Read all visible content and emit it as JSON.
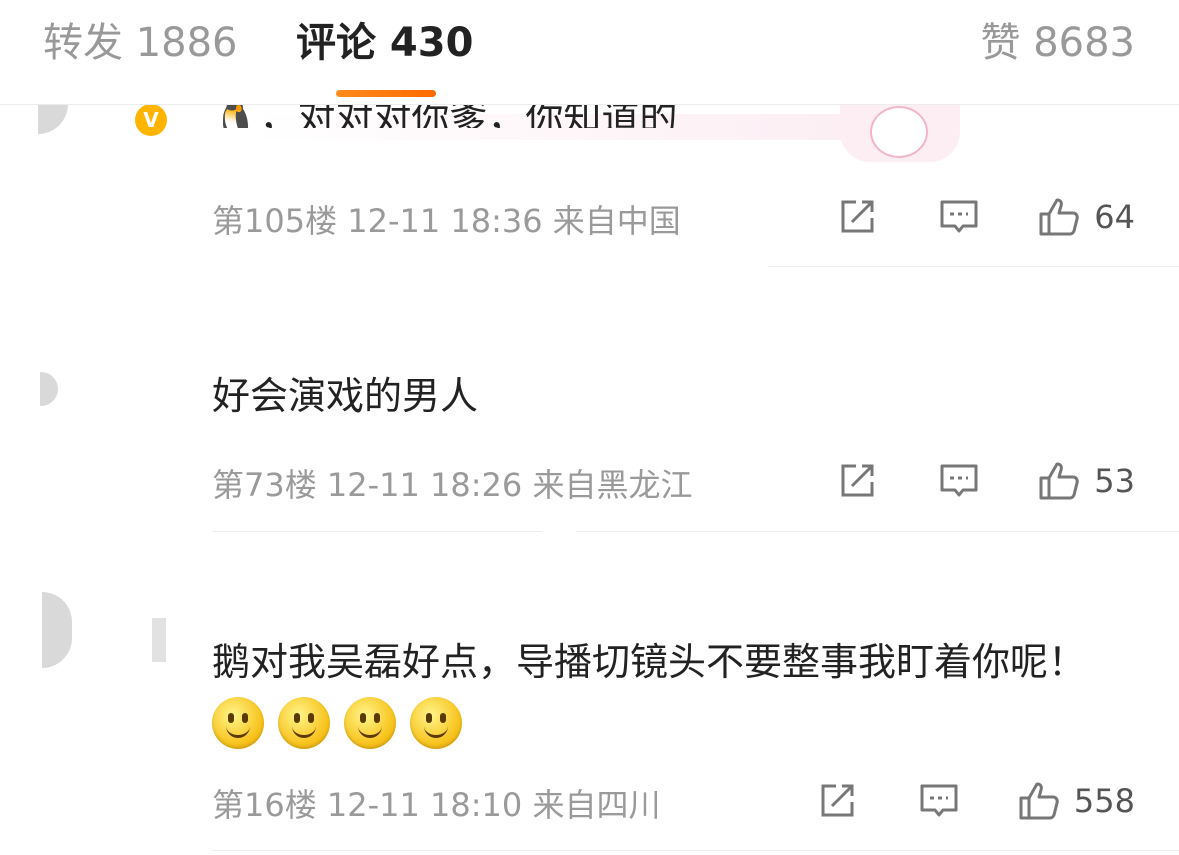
{
  "tabs": {
    "forward": "转发 1886",
    "comments": "评论 430",
    "likes": "赞 8683"
  },
  "comments": [
    {
      "text_partial": "🐧，对对对你爹，你知道的",
      "verified_badge": "V",
      "meta": "第105楼 12-11 18:36 来自中国",
      "likes": "64"
    },
    {
      "text": "好会演戏的男人",
      "meta": "第73楼 12-11 18:26 来自黑龙江",
      "likes": "53"
    },
    {
      "text": "鹅对我吴磊好点，导播切镜头不要整事我盯着你呢！",
      "emoji_count": 4,
      "meta": "第16楼 12-11 18:10 来自四川",
      "likes": "558"
    }
  ],
  "icons": {
    "share": "share-icon",
    "reply": "comment-icon",
    "like": "thumbs-up-icon",
    "emoji": "smile-emoji-icon"
  },
  "colors": {
    "accent": "#ff7a00",
    "muted_text": "#9a9a9a",
    "badge": "#ffb400"
  }
}
